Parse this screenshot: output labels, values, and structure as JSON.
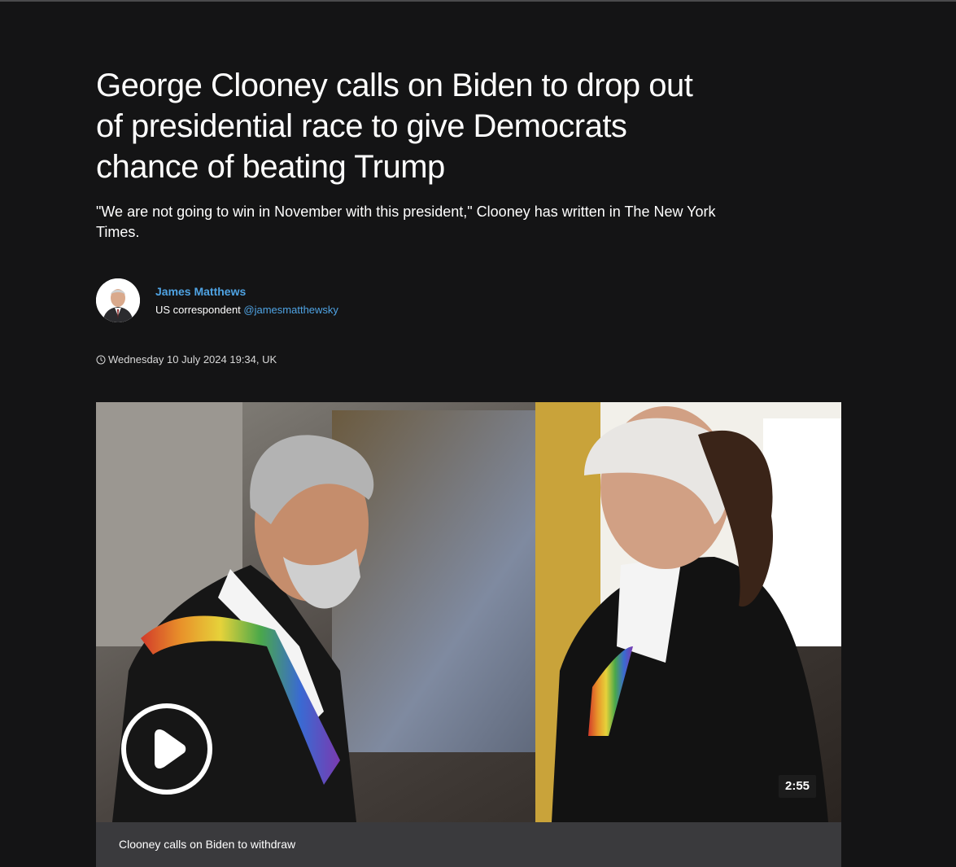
{
  "article": {
    "headline": "George Clooney calls on Biden to drop out of presidential race to give Democrats chance of beating Trump",
    "standfirst": "\"We are not going to win in November with this president,\" Clooney has written in The New York Times.",
    "author": {
      "name": "James Matthews",
      "role": "US correspondent",
      "handle": "@jamesmatthewsky"
    },
    "timestamp": "Wednesday 10 July 2024 19:34, UK"
  },
  "video": {
    "duration": "2:55",
    "caption": "Clooney calls on Biden to withdraw",
    "play_icon": "play-icon"
  },
  "colors": {
    "background": "#141415",
    "link": "#4fa3e3",
    "caption_bar": "#3a3a3d"
  }
}
